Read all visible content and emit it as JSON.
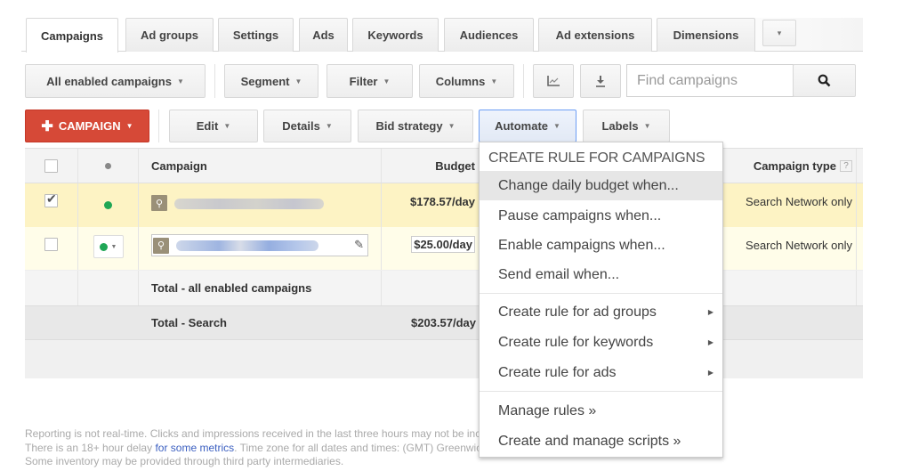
{
  "tabs": [
    {
      "label": "Campaigns",
      "active": true
    },
    {
      "label": "Ad groups"
    },
    {
      "label": "Settings"
    },
    {
      "label": "Ads"
    },
    {
      "label": "Keywords"
    },
    {
      "label": "Audiences"
    },
    {
      "label": "Ad extensions"
    },
    {
      "label": "Dimensions"
    }
  ],
  "tabs_more_icon": "▾",
  "toolbar": {
    "view_filter": "All enabled campaigns",
    "segment": "Segment",
    "filter": "Filter",
    "columns": "Columns",
    "chart_icon": "chart-icon",
    "download_icon": "download-icon",
    "search_placeholder": "Find campaigns",
    "search_icon": "search-icon"
  },
  "actions": {
    "campaign": "CAMPAIGN",
    "edit": "Edit",
    "details": "Details",
    "bid_strategy": "Bid strategy",
    "automate": "Automate",
    "labels": "Labels"
  },
  "table": {
    "headers": {
      "campaign": "Campaign",
      "budget": "Budget",
      "campaign_type": "Campaign type",
      "help": "?"
    },
    "rows": [
      {
        "selected": true,
        "status": "enabled",
        "budget": "$178.57/day",
        "campaign_type": "Search Network only"
      },
      {
        "selected": false,
        "status": "enabled",
        "budget": "$25.00/day",
        "campaign_type": "Search Network only"
      }
    ],
    "totals": [
      {
        "label": "Total - all enabled campaigns",
        "budget": ""
      },
      {
        "label": "Total - Search",
        "budget": "$203.57/day"
      }
    ]
  },
  "automate_menu": {
    "heading": "CREATE RULE FOR CAMPAIGNS",
    "items": [
      {
        "label": "Change daily budget when...",
        "highlighted": true
      },
      {
        "label": "Pause campaigns when..."
      },
      {
        "label": "Enable campaigns when..."
      },
      {
        "label": "Send email when..."
      }
    ],
    "submenus": [
      {
        "label": "Create rule for ad groups"
      },
      {
        "label": "Create rule for keywords"
      },
      {
        "label": "Create rule for ads"
      }
    ],
    "links": [
      {
        "label": "Manage rules »"
      },
      {
        "label": "Create and manage scripts »"
      }
    ]
  },
  "footer": {
    "line1": "Reporting is not real-time. Clicks and impressions received in the last three hours may not be included here.",
    "line2_before": "There is an 18+ hour delay ",
    "line2_link": "for some metrics",
    "line2_after": ". Time zone for all dates and times: (GMT) Greenwich Mean Time.",
    "line3": "Some inventory may be provided through third party intermediaries."
  }
}
